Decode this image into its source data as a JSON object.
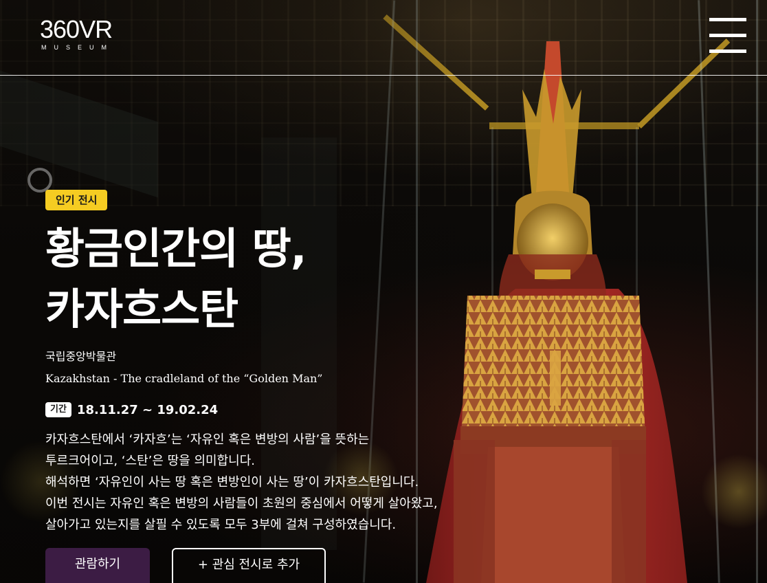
{
  "logo": {
    "main": "360VR",
    "sub": "MUSEUM"
  },
  "menu": {
    "icon": "hamburger-menu-icon"
  },
  "exhibit": {
    "badge": "인기 전시",
    "title_line1": "황금인간의 땅,",
    "title_line2": "카자흐스탄",
    "venue": "국립중앙박물관",
    "subtitle": "Kazakhstan - The cradleland of the “Golden Man”",
    "period_label": "기간",
    "period_value": "18.11.27 ~ 19.02.24",
    "description": [
      "카자흐스탄에서 ‘카자흐’는 ‘자유인 혹은 변방의 사람’을 뜻하는",
      "투르크어이고, ‘스탄’은 땅을 의미합니다.",
      "해석하면 ‘자유인이 사는 땅 혹은 변방인이 사는 땅’이 카자흐스탄입니다.",
      "이번 전시는 자유인 혹은 변방의 사람들이 초원의 중심에서 어떻게 살아왔고,",
      "살아가고 있는지를 살필 수 있도록 모두 3부에 걸쳐 구성하였습니다."
    ]
  },
  "actions": {
    "view_label": "관람하기",
    "wishlist_label": "+ 관심 전시로 추가"
  },
  "colors": {
    "badge": "#f5cc22",
    "primary_button": "#3c1c44",
    "text": "#ffffff"
  }
}
